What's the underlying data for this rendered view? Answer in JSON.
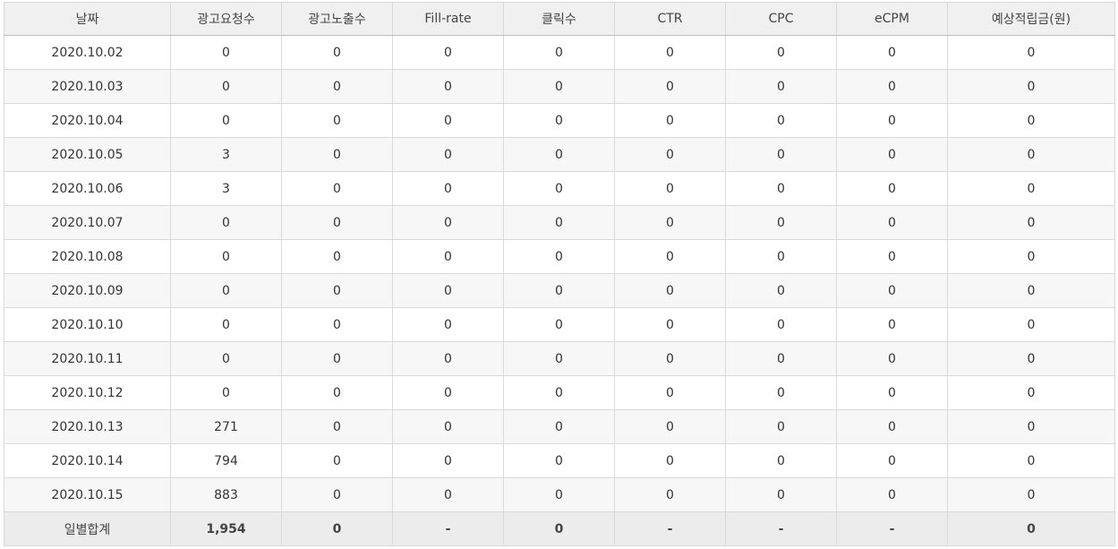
{
  "table": {
    "headers": [
      "날짜",
      "광고요청수",
      "광고노출수",
      "Fill-rate",
      "클릭수",
      "CTR",
      "CPC",
      "eCPM",
      "예상적립금(원)"
    ],
    "rows": [
      [
        "2020.10.02",
        "0",
        "0",
        "0",
        "0",
        "0",
        "0",
        "0",
        "0"
      ],
      [
        "2020.10.03",
        "0",
        "0",
        "0",
        "0",
        "0",
        "0",
        "0",
        "0"
      ],
      [
        "2020.10.04",
        "0",
        "0",
        "0",
        "0",
        "0",
        "0",
        "0",
        "0"
      ],
      [
        "2020.10.05",
        "3",
        "0",
        "0",
        "0",
        "0",
        "0",
        "0",
        "0"
      ],
      [
        "2020.10.06",
        "3",
        "0",
        "0",
        "0",
        "0",
        "0",
        "0",
        "0"
      ],
      [
        "2020.10.07",
        "0",
        "0",
        "0",
        "0",
        "0",
        "0",
        "0",
        "0"
      ],
      [
        "2020.10.08",
        "0",
        "0",
        "0",
        "0",
        "0",
        "0",
        "0",
        "0"
      ],
      [
        "2020.10.09",
        "0",
        "0",
        "0",
        "0",
        "0",
        "0",
        "0",
        "0"
      ],
      [
        "2020.10.10",
        "0",
        "0",
        "0",
        "0",
        "0",
        "0",
        "0",
        "0"
      ],
      [
        "2020.10.11",
        "0",
        "0",
        "0",
        "0",
        "0",
        "0",
        "0",
        "0"
      ],
      [
        "2020.10.12",
        "0",
        "0",
        "0",
        "0",
        "0",
        "0",
        "0",
        "0"
      ],
      [
        "2020.10.13",
        "271",
        "0",
        "0",
        "0",
        "0",
        "0",
        "0",
        "0"
      ],
      [
        "2020.10.14",
        "794",
        "0",
        "0",
        "0",
        "0",
        "0",
        "0",
        "0"
      ],
      [
        "2020.10.15",
        "883",
        "0",
        "0",
        "0",
        "0",
        "0",
        "0",
        "0"
      ]
    ],
    "footer": [
      "일별합계",
      "1,954",
      "0",
      "-",
      "0",
      "-",
      "-",
      "-",
      "0"
    ]
  }
}
